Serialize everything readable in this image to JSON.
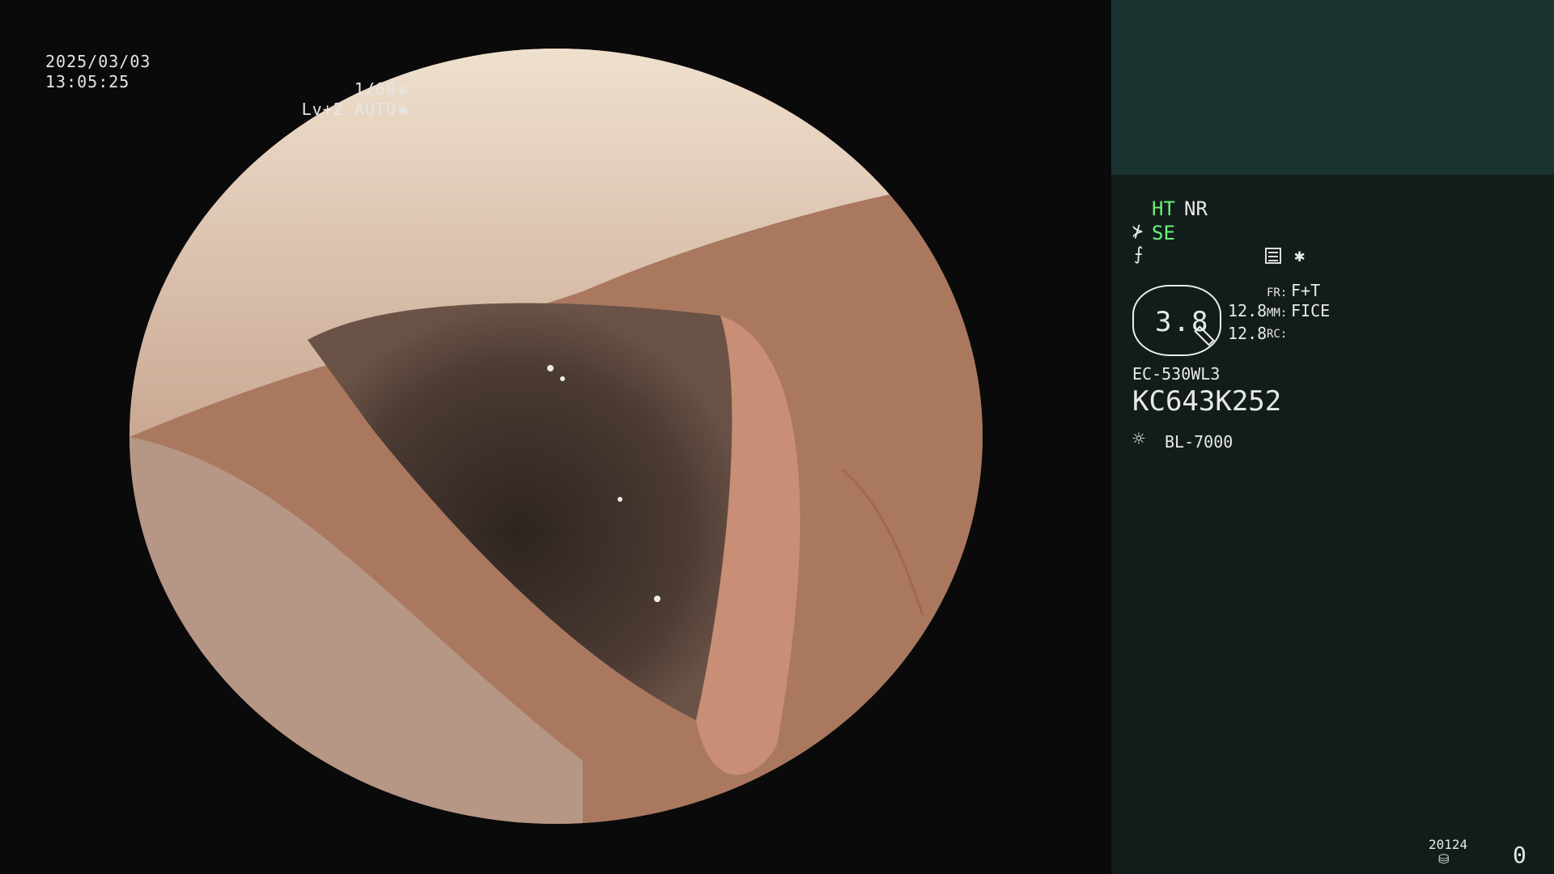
{
  "osd": {
    "date": "2025/03/03",
    "time": "13:05:25",
    "shutter": "1/60",
    "shutter_icon": "aperture-icon",
    "level": "Lv+2 AUTO",
    "level_icon": "iris-icon"
  },
  "panel": {
    "ht": "HT",
    "nr": "NR",
    "se": "SE",
    "zoom": "3.8",
    "value_1": "12.8",
    "value_2": "12.8",
    "fr_label": "FR:",
    "fr_value": "F+T",
    "mm_label": "MM:",
    "mm_value": "FICE",
    "rc_label": "RC:",
    "model": "EC-530WL3",
    "serial": "KC643K252",
    "light_source": "BL-7000",
    "counter_small": "20124",
    "count": "0"
  },
  "colors": {
    "accent_green": "#6ef07a",
    "panel_bg": "#121d1b",
    "panel_top_bg": "#1b3330"
  }
}
